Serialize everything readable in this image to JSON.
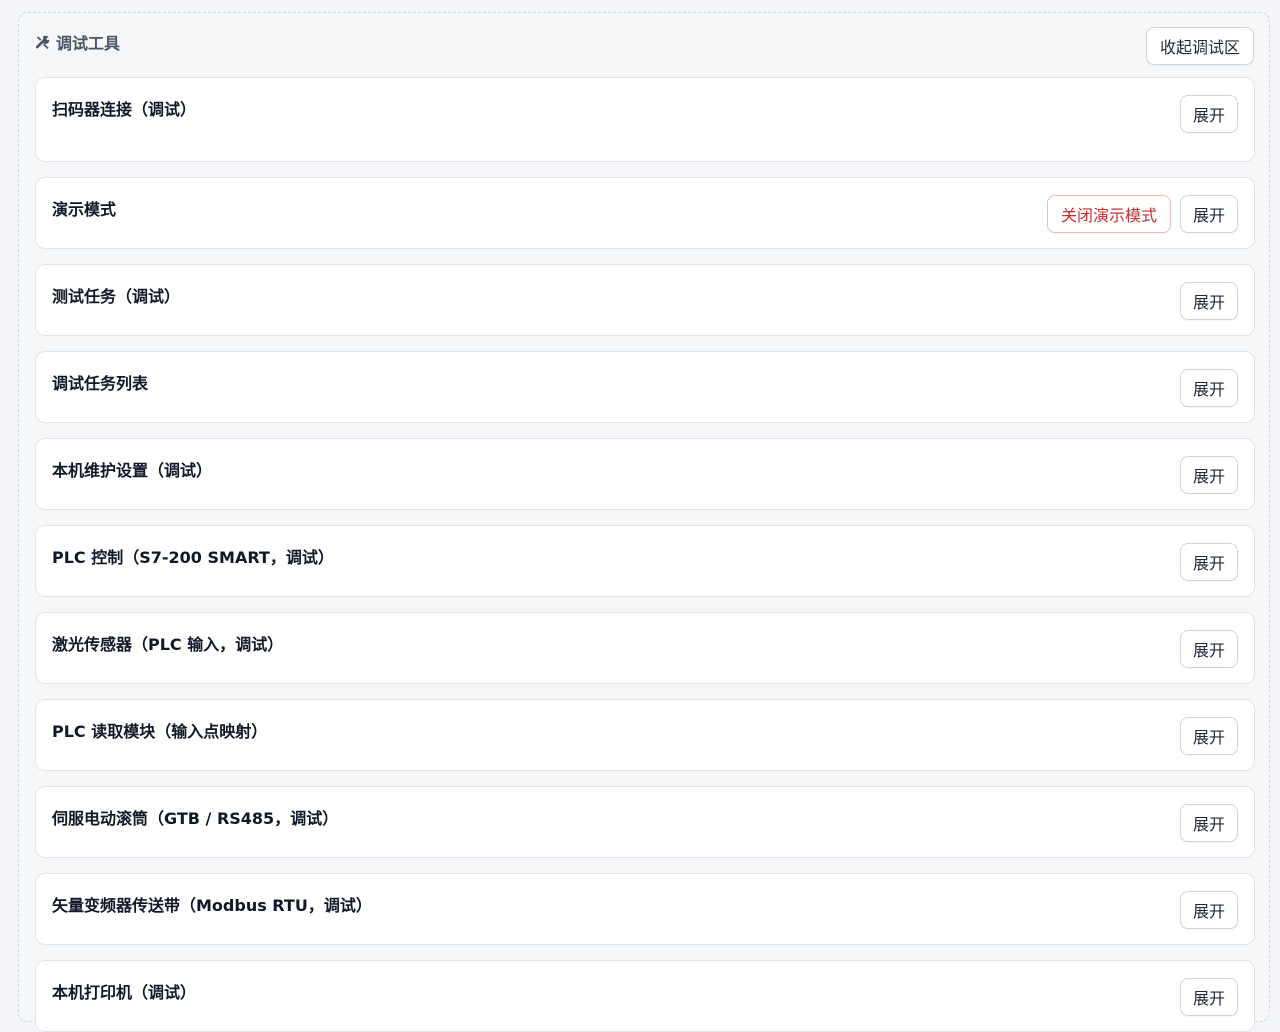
{
  "panel": {
    "title": "调试工具",
    "title_icon": "tools-icon",
    "collapse_label": "收起调试区"
  },
  "sections": [
    {
      "title": "扫码器连接（调试）",
      "expand_label": "展开"
    },
    {
      "title": "演示模式",
      "expand_label": "展开",
      "extra_label": "关闭演示模式"
    },
    {
      "title": "测试任务（调试）",
      "expand_label": "展开"
    },
    {
      "title": "调试任务列表",
      "expand_label": "展开"
    },
    {
      "title": "本机维护设置（调试）",
      "expand_label": "展开"
    },
    {
      "title": "PLC 控制（S7-200 SMART，调试）",
      "expand_label": "展开"
    },
    {
      "title": "激光传感器（PLC 输入，调试）",
      "expand_label": "展开"
    },
    {
      "title": "PLC 读取模块（输入点映射）",
      "expand_label": "展开"
    },
    {
      "title": "伺服电动滚筒（GTB / RS485，调试）",
      "expand_label": "展开"
    },
    {
      "title": "矢量变频器传送带（Modbus RTU，调试）",
      "expand_label": "展开"
    },
    {
      "title": "本机打印机（调试）",
      "expand_label": "展开"
    }
  ],
  "colors": {
    "danger_text": "#c53030",
    "danger_border": "#f1b8b8"
  }
}
